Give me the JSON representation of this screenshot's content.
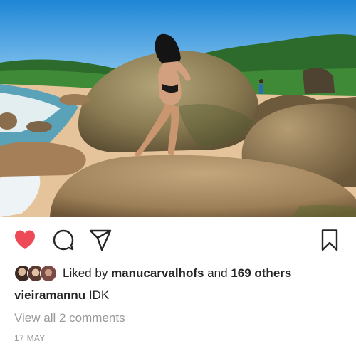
{
  "post": {
    "image": {
      "alt": ""
    },
    "actions": {
      "like_icon": "heart-filled-icon",
      "comment_icon": "comment-bubble-icon",
      "share_icon": "paper-plane-icon",
      "save_icon": "bookmark-icon",
      "liked_color": "#ed4956"
    },
    "likes": {
      "prefix": "Liked by",
      "user": "manucarvalhofs",
      "conjunction": "and",
      "others": "169 others"
    },
    "caption": {
      "username": "vieiramannu",
      "text": "IDK"
    },
    "comments_link": "View all 2 comments",
    "date": "17 MAY"
  }
}
